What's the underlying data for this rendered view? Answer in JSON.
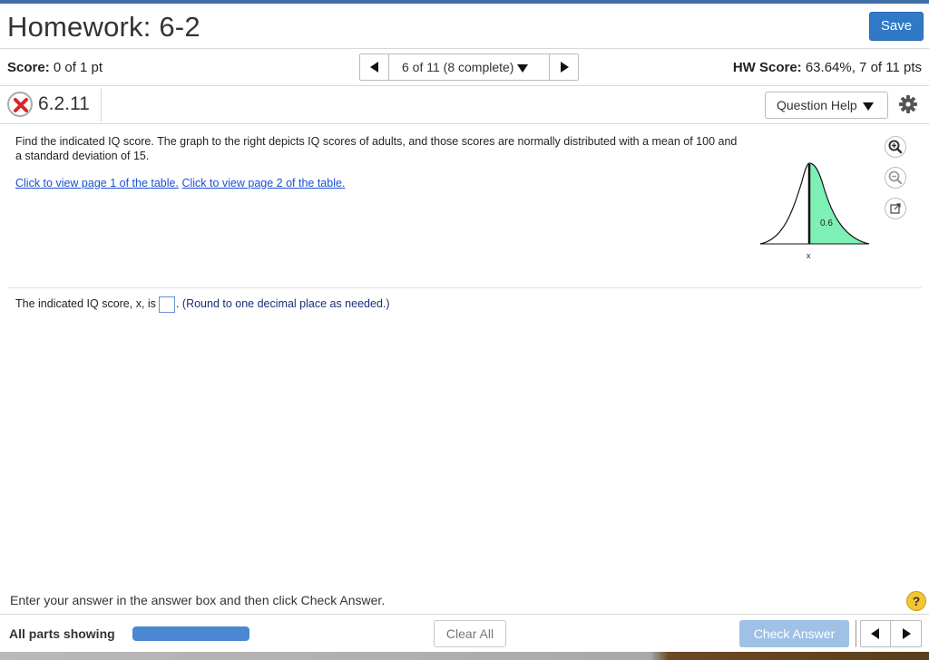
{
  "header": {
    "title": "Homework: 6-2",
    "save_label": "Save"
  },
  "score_bar": {
    "score_label": "Score:",
    "score_value": "0 of 1 pt",
    "nav_label": "6 of 11 (8 complete)",
    "hw_score_label": "HW Score:",
    "hw_score_value": "63.64%, 7 of 11 pts"
  },
  "question": {
    "number": "6.2.11",
    "status": "incorrect",
    "help_label": "Question Help",
    "text": "Find the indicated IQ score. The graph to the right depicts IQ scores of adults, and those scores are normally distributed with a mean of 100 and a standard deviation of 15.",
    "link1": "Click to view page 1 of the table.",
    "link2": "Click to view page 2 of the table.",
    "graph": {
      "shaded_area_label": "0.6",
      "x_label": "x",
      "fill_color": "#7ef0b6"
    },
    "answer_prefix": "The indicated IQ score, x, is",
    "answer_value": "",
    "answer_suffix": ".",
    "answer_note": "(Round to one decimal place as needed.)"
  },
  "footer": {
    "instruction": "Enter your answer in the answer box and then click Check Answer.",
    "help_symbol": "?",
    "parts_label": "All parts showing",
    "progress_fraction": 1.0,
    "clear_label": "Clear All",
    "check_label": "Check Answer"
  },
  "colors": {
    "accent": "#2f79c7",
    "link": "#1a4fd6",
    "incorrect": "#d9262a"
  }
}
